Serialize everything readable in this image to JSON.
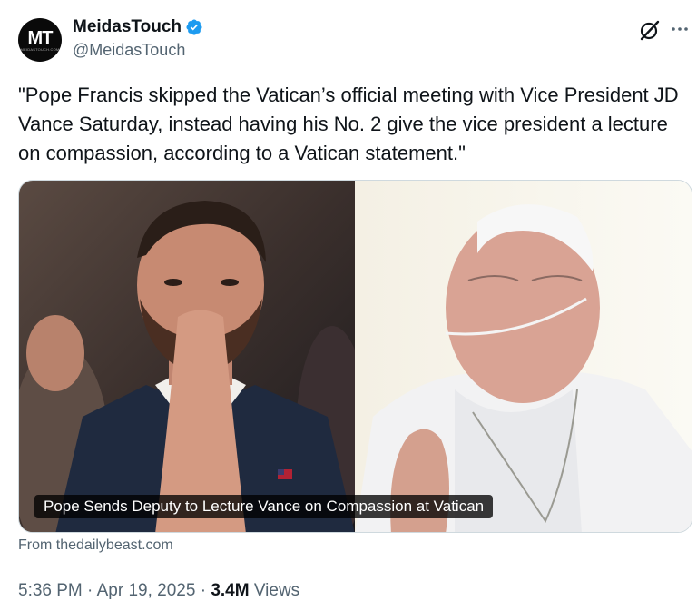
{
  "author": {
    "avatar_text": "MT",
    "avatar_subtext": "MEIDASTOUCH.COM",
    "name": "MeidasTouch",
    "handle": "@MeidasTouch",
    "verified": true
  },
  "icons": {
    "grok": "grok-slash-icon",
    "more": "more-horizontal-icon",
    "verified": "verified-badge-icon"
  },
  "tweet": {
    "text": "\"Pope Francis skipped the Vatican’s official meeting with Vice President JD Vance Saturday, instead having his No. 2 give the vice president a lecture on compassion, according to a Vatican statement.\""
  },
  "card": {
    "caption": "Pope Sends Deputy to Lecture Vance on Compassion at Vatican",
    "source": "From thedailybeast.com"
  },
  "meta": {
    "time": "5:36 PM",
    "date": "Apr 19, 2025",
    "views_count": "3.4M",
    "views_label": "Views"
  },
  "colors": {
    "verified_blue": "#1d9bf0",
    "secondary_text": "#536471",
    "primary_text": "#0f1419"
  }
}
